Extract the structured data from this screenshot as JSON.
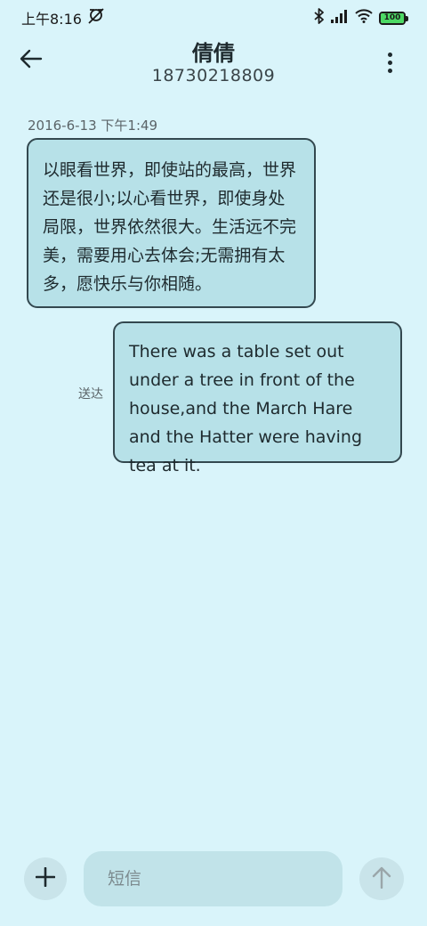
{
  "status_bar": {
    "time": "上午8:16",
    "battery": "100",
    "icons": [
      "alarm-off-icon",
      "bluetooth-icon",
      "signal-icon",
      "wifi-icon",
      "battery-icon"
    ]
  },
  "header": {
    "contact_name": "倩倩",
    "contact_number": "18730218809",
    "icons": [
      "back-arrow-icon",
      "more-vert-icon"
    ]
  },
  "conversation": {
    "timestamp": "2016-6-13 下午1:49",
    "messages": [
      {
        "direction": "received",
        "text": "以眼看世界，即使站的最高，世界还是很小;以心看世界，即使身处局限，世界依然很大。生活远不完美，需要用心去体会;无需拥有太多，愿快乐与你相随。"
      },
      {
        "direction": "sent",
        "text": "There was a table set out under a tree in front of the house,and the March Hare and the Hatter were having tea at it.",
        "status": "送达"
      }
    ]
  },
  "composer": {
    "placeholder": "短信",
    "icons": [
      "plus-icon",
      "send-arrow-icon"
    ]
  },
  "colors": {
    "background": "#d9f4fa",
    "bubble": "#b7e1e8",
    "bubble_border": "#33484f"
  }
}
